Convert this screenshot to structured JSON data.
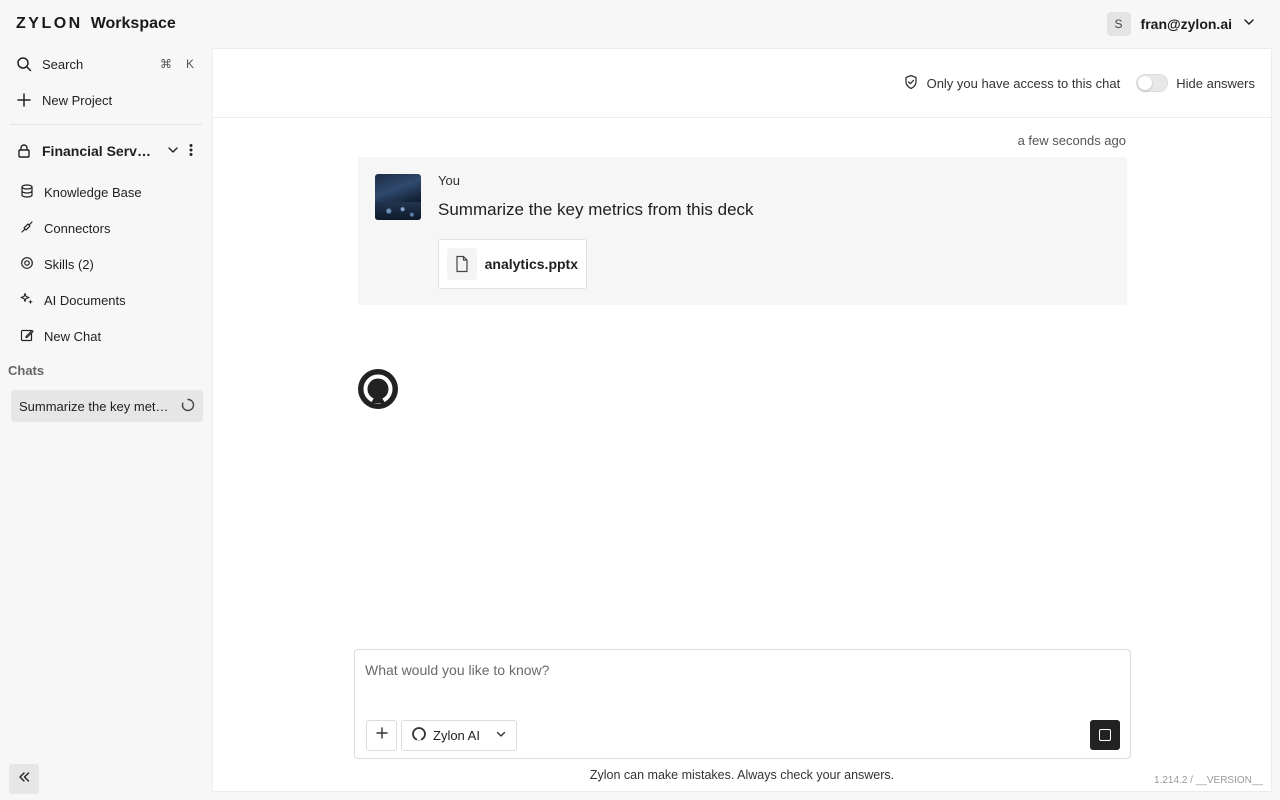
{
  "header": {
    "brand_logo": "ZYLON",
    "brand_product": "Workspace",
    "user_initial": "S",
    "user_email": "fran@zylon.ai"
  },
  "sidebar": {
    "search_label": "Search",
    "search_shortcut_mod": "⌘",
    "search_shortcut_key": "K",
    "new_project_label": "New Project",
    "project_name": "Financial Services",
    "project_items": [
      {
        "label": "Knowledge Base",
        "icon": "database-icon"
      },
      {
        "label": "Connectors",
        "icon": "plug-icon"
      },
      {
        "label": "Skills (2)",
        "icon": "skills-icon"
      },
      {
        "label": "AI Documents",
        "icon": "sparkles-icon"
      },
      {
        "label": "New Chat",
        "icon": "edit-icon"
      }
    ],
    "chats_label": "Chats",
    "chats": [
      {
        "title": "Summarize the key metrics from this deck",
        "loading": true
      }
    ]
  },
  "chat": {
    "access_label": "Only you have access to this chat",
    "hide_answers_label": "Hide answers",
    "hide_answers_on": false,
    "timestamp": "a few seconds ago",
    "message": {
      "author": "You",
      "text": "Summarize the key metrics from this deck",
      "attachment_name": "analytics.pptx"
    }
  },
  "composer": {
    "placeholder": "What would you like to know?",
    "model_name": "Zylon AI"
  },
  "footer": {
    "disclaimer": "Zylon can make mistakes. Always check your answers.",
    "version": "1.214.2 / __VERSION__"
  }
}
